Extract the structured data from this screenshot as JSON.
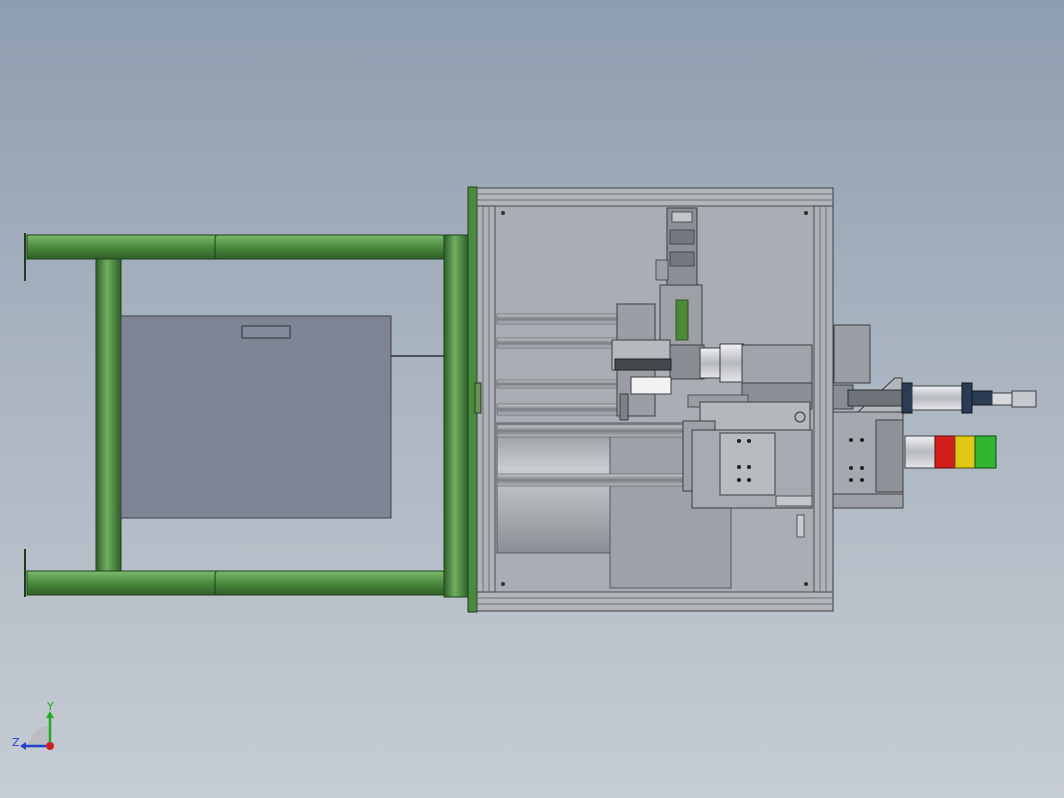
{
  "viewport": {
    "background_top": "#8e9db0",
    "background_bottom": "#c6ccd3"
  },
  "colors": {
    "frame_green": "#4a8a3e",
    "frame_green_dark": "#2f5e27",
    "frame_green_light": "#66a858",
    "aluminum": "#9a9ea4",
    "aluminum_dark": "#5d6167",
    "panel": "#a8adb4",
    "cabinet_box": "#7f8495",
    "stack_red": "#d41e1e",
    "stack_yellow": "#e2c814",
    "stack_green": "#2fb52f"
  },
  "axis_triad": {
    "y_label": "Y",
    "z_label": "Z",
    "y_color": "#22aa22",
    "z_color": "#2244cc",
    "x_color": "#cc2222"
  }
}
